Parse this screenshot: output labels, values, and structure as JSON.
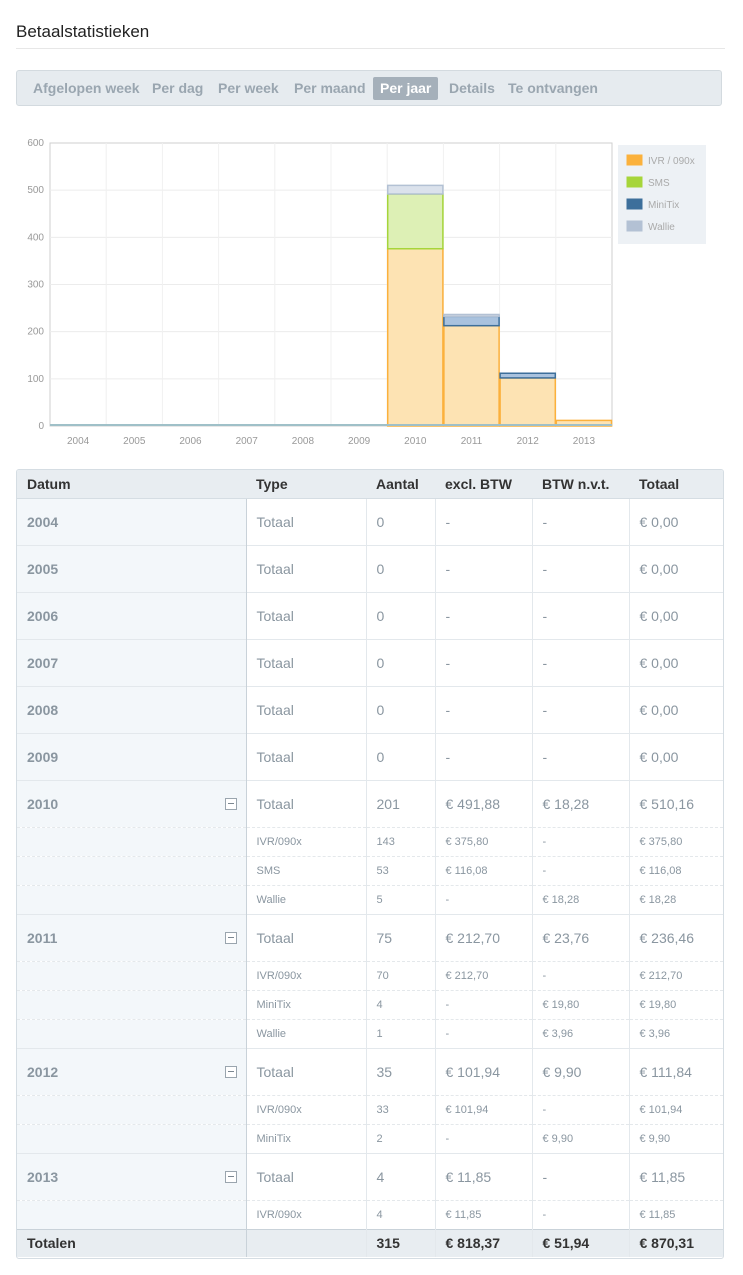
{
  "page": {
    "title": "Betaalstatistieken"
  },
  "tabs": [
    {
      "label": "Afgelopen week",
      "active": false
    },
    {
      "label": "Per dag",
      "active": false
    },
    {
      "label": "Per week",
      "active": false
    },
    {
      "label": "Per maand",
      "active": false
    },
    {
      "label": "Per jaar",
      "active": true
    },
    {
      "label": "Details",
      "active": false
    },
    {
      "label": "Te ontvangen",
      "active": false
    }
  ],
  "chart_data": {
    "type": "bar",
    "stacked": true,
    "categories": [
      "2004",
      "2005",
      "2006",
      "2007",
      "2008",
      "2009",
      "2010",
      "2011",
      "2012",
      "2013"
    ],
    "series": [
      {
        "name": "IVR / 090x",
        "color": "#fbb13c",
        "fill": "#fde3b3",
        "values": [
          0,
          0,
          0,
          0,
          0,
          0,
          375.8,
          212.7,
          101.94,
          11.85
        ]
      },
      {
        "name": "SMS",
        "color": "#a6d53a",
        "fill": "#ddf0b5",
        "values": [
          0,
          0,
          0,
          0,
          0,
          0,
          116.08,
          0,
          0,
          0
        ]
      },
      {
        "name": "MiniTix",
        "color": "#3d6f9b",
        "fill": "#a9c2de",
        "values": [
          0,
          0,
          0,
          0,
          0,
          0,
          0,
          19.8,
          9.9,
          0
        ]
      },
      {
        "name": "Wallie",
        "color": "#b3c1d4",
        "fill": "#dbe2ec",
        "values": [
          0,
          0,
          0,
          0,
          0,
          0,
          18.28,
          3.96,
          0,
          0
        ]
      }
    ],
    "ylim": [
      0,
      600
    ],
    "yticks": [
      0,
      100,
      200,
      300,
      400,
      500,
      600
    ],
    "grid": true,
    "legend": "right"
  },
  "table": {
    "headers": {
      "date": "Datum",
      "type": "Type",
      "count": "Aantal",
      "excl": "excl. BTW",
      "btw": "BTW n.v.t.",
      "total": "Totaal"
    },
    "groups": [
      {
        "year": "2004",
        "collapsible": false,
        "total": {
          "type": "Totaal",
          "count": "0",
          "excl": "-",
          "btw": "-",
          "total": "€ 0,00"
        },
        "rows": []
      },
      {
        "year": "2005",
        "collapsible": false,
        "total": {
          "type": "Totaal",
          "count": "0",
          "excl": "-",
          "btw": "-",
          "total": "€ 0,00"
        },
        "rows": []
      },
      {
        "year": "2006",
        "collapsible": false,
        "total": {
          "type": "Totaal",
          "count": "0",
          "excl": "-",
          "btw": "-",
          "total": "€ 0,00"
        },
        "rows": []
      },
      {
        "year": "2007",
        "collapsible": false,
        "total": {
          "type": "Totaal",
          "count": "0",
          "excl": "-",
          "btw": "-",
          "total": "€ 0,00"
        },
        "rows": []
      },
      {
        "year": "2008",
        "collapsible": false,
        "total": {
          "type": "Totaal",
          "count": "0",
          "excl": "-",
          "btw": "-",
          "total": "€ 0,00"
        },
        "rows": []
      },
      {
        "year": "2009",
        "collapsible": false,
        "total": {
          "type": "Totaal",
          "count": "0",
          "excl": "-",
          "btw": "-",
          "total": "€ 0,00"
        },
        "rows": []
      },
      {
        "year": "2010",
        "collapsible": true,
        "total": {
          "type": "Totaal",
          "count": "201",
          "excl": "€ 491,88",
          "btw": "€ 18,28",
          "total": "€ 510,16"
        },
        "rows": [
          {
            "type": "IVR/090x",
            "count": "143",
            "excl": "€ 375,80",
            "btw": "-",
            "total": "€ 375,80"
          },
          {
            "type": "SMS",
            "count": "53",
            "excl": "€ 116,08",
            "btw": "-",
            "total": "€ 116,08"
          },
          {
            "type": "Wallie",
            "count": "5",
            "excl": "-",
            "btw": "€ 18,28",
            "total": "€ 18,28"
          }
        ]
      },
      {
        "year": "2011",
        "collapsible": true,
        "total": {
          "type": "Totaal",
          "count": "75",
          "excl": "€ 212,70",
          "btw": "€ 23,76",
          "total": "€ 236,46"
        },
        "rows": [
          {
            "type": "IVR/090x",
            "count": "70",
            "excl": "€ 212,70",
            "btw": "-",
            "total": "€ 212,70"
          },
          {
            "type": "MiniTix",
            "count": "4",
            "excl": "-",
            "btw": "€ 19,80",
            "total": "€ 19,80"
          },
          {
            "type": "Wallie",
            "count": "1",
            "excl": "-",
            "btw": "€ 3,96",
            "total": "€ 3,96"
          }
        ]
      },
      {
        "year": "2012",
        "collapsible": true,
        "total": {
          "type": "Totaal",
          "count": "35",
          "excl": "€ 101,94",
          "btw": "€ 9,90",
          "total": "€ 111,84"
        },
        "rows": [
          {
            "type": "IVR/090x",
            "count": "33",
            "excl": "€ 101,94",
            "btw": "-",
            "total": "€ 101,94"
          },
          {
            "type": "MiniTix",
            "count": "2",
            "excl": "-",
            "btw": "€ 9,90",
            "total": "€ 9,90"
          }
        ]
      },
      {
        "year": "2013",
        "collapsible": true,
        "total": {
          "type": "Totaal",
          "count": "4",
          "excl": "€ 11,85",
          "btw": "-",
          "total": "€ 11,85"
        },
        "rows": [
          {
            "type": "IVR/090x",
            "count": "4",
            "excl": "€ 11,85",
            "btw": "-",
            "total": "€ 11,85"
          }
        ]
      }
    ],
    "footer": {
      "label": "Totalen",
      "type": "",
      "count": "315",
      "excl": "€ 818,37",
      "btw": "€ 51,94",
      "total": "€ 870,31"
    }
  }
}
